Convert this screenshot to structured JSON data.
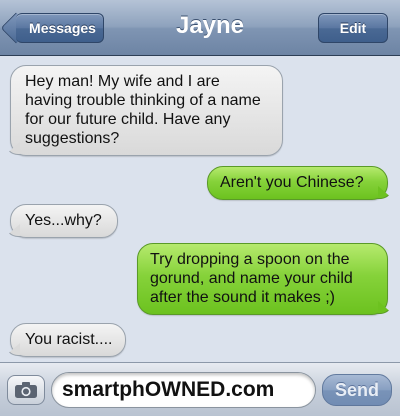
{
  "header": {
    "back_label": "Messages",
    "title": "Jayne",
    "edit_label": "Edit"
  },
  "messages": [
    {
      "direction": "incoming",
      "text": "Hey man! My wife and I are having trouble thinking of a name for our future child. Have any suggestions?"
    },
    {
      "direction": "outgoing",
      "text": "Aren't you Chinese?"
    },
    {
      "direction": "incoming",
      "text": "Yes...why?"
    },
    {
      "direction": "outgoing",
      "text": "Try dropping a spoon on the gorund, and name your child after the sound it makes ;)"
    },
    {
      "direction": "incoming",
      "text": "You racist...."
    }
  ],
  "composer": {
    "field_text": "smartphOWNED.com",
    "send_label": "Send",
    "camera_icon": "camera-icon"
  },
  "colors": {
    "incoming_bubble": "#e6e6e6",
    "outgoing_bubble": "#86d23a",
    "background": "#dbe2ed",
    "header": "#8ea2bd"
  }
}
